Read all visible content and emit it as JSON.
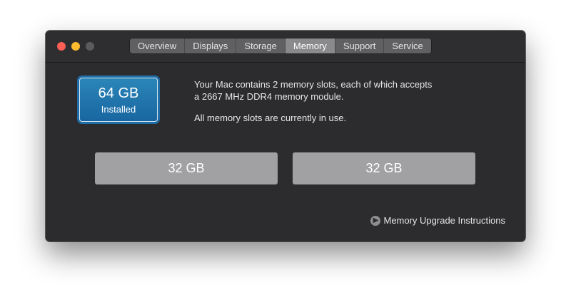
{
  "window": {
    "tabs": [
      {
        "label": "Overview"
      },
      {
        "label": "Displays"
      },
      {
        "label": "Storage"
      },
      {
        "label": "Memory"
      },
      {
        "label": "Support"
      },
      {
        "label": "Service"
      }
    ],
    "active_tab": "Memory"
  },
  "memory": {
    "installed_size": "64 GB",
    "installed_label": "Installed",
    "description_line1": "Your Mac contains 2 memory slots, each of which accepts",
    "description_line2": "a 2667 MHz DDR4 memory module.",
    "status_text": "All memory slots are currently in use.",
    "slots": [
      {
        "size": "32 GB"
      },
      {
        "size": "32 GB"
      }
    ],
    "upgrade_link_label": "Memory Upgrade Instructions",
    "upgrade_icon": "arrow-right-circle-icon"
  },
  "colors": {
    "window_bg": "#2c2c2e",
    "installed_accent": "#1f6ea8",
    "slot_bg": "#a1a1a3",
    "close": "#ff5f57",
    "minimize": "#febc2e"
  }
}
